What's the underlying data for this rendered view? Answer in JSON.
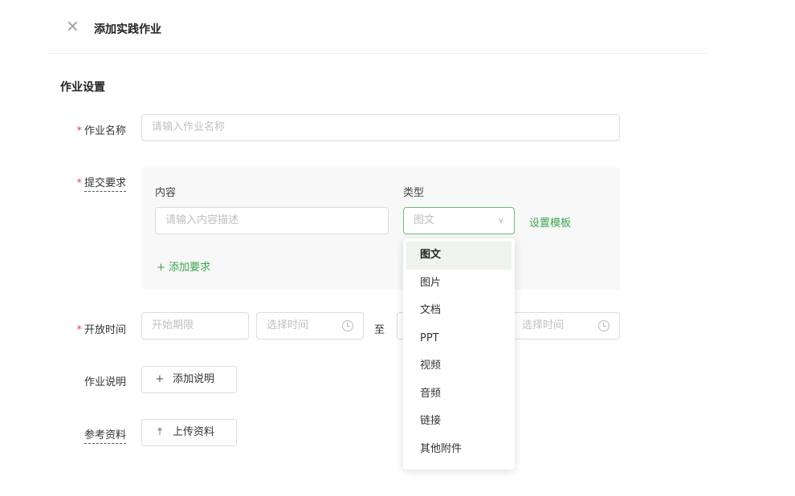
{
  "header": {
    "title": "添加实践作业",
    "close_icon": "close-icon"
  },
  "section": {
    "title": "作业设置"
  },
  "required_mark": "*",
  "name_field": {
    "label": "作业名称",
    "placeholder": "请输入作业名称"
  },
  "submission": {
    "label": "提交要求",
    "content_label": "内容",
    "type_label": "类型",
    "content_placeholder": "请输入内容描述",
    "type_selected": "图文",
    "template_link": "设置模板",
    "add_requirement": "+ 添加要求"
  },
  "open_time": {
    "label": "开放时间",
    "start_date_placeholder": "开始期限",
    "start_time_placeholder": "选择时间",
    "separator": "至",
    "end_time_placeholder": "选择时间"
  },
  "description": {
    "label": "作业说明",
    "button": "添加说明",
    "icon": "plus-icon"
  },
  "reference": {
    "label": "参考资料",
    "button": "上传资料",
    "icon": "upload-icon"
  },
  "type_options": [
    "图文",
    "图片",
    "文档",
    "PPT",
    "视频",
    "音频",
    "链接",
    "其他附件"
  ],
  "colors": {
    "accent": "#3ca550",
    "required": "#e5484d",
    "option_highlight": "#eef4ec"
  }
}
